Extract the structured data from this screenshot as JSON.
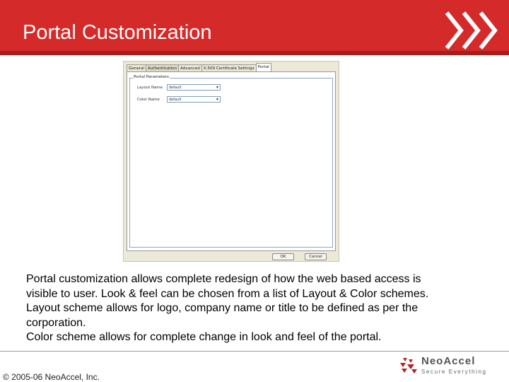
{
  "slide": {
    "title": "Portal Customization",
    "accent_color": "#d42a2a",
    "decor_icon": "triple-chevron-right-icon"
  },
  "dialog": {
    "tabs": [
      "General",
      "Authentication",
      "Advanced",
      "X.509 Certificate Settings",
      "Portal"
    ],
    "active_tab": "Portal",
    "group_title": "Portal Parameters",
    "fields": [
      {
        "label": "Layout Name",
        "value": "default"
      },
      {
        "label": "Color Name",
        "value": "default"
      }
    ],
    "ok_label": "OK",
    "cancel_label": "Cancel"
  },
  "body": {
    "lines": [
      "Portal customization allows complete redesign of how the web based access is",
      "visible to user. Look & feel can be chosen from a list of Layout & Color schemes.",
      "Layout scheme allows for logo, company name or title to be defined as per the",
      "corporation.",
      "Color scheme allows for complete change in look and feel of the portal."
    ]
  },
  "footer": {
    "copyright": "© 2005-06 NeoAccel, Inc.",
    "logo_name": "NeoAccel",
    "logo_tagline": "Secure Everything",
    "logo_icon": "neoaccel-logo-icon"
  }
}
